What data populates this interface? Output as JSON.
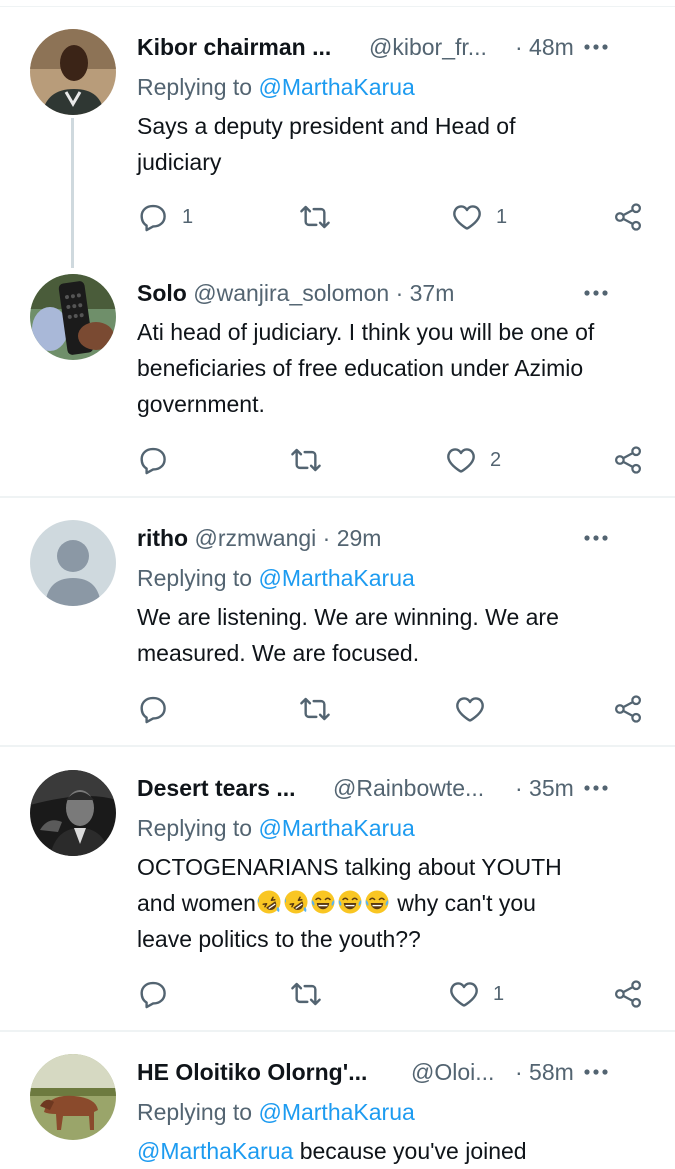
{
  "tweets": [
    {
      "name": "Kibor chairman ...",
      "handle": "@kibor_fr...",
      "time": "· 48m",
      "replying_prefix": "Replying to ",
      "replying_to": "@MarthaKarua",
      "text": "Says a deputy president and Head of judiciary",
      "replies": "1",
      "retweets": "",
      "likes": "1"
    },
    {
      "name": "Solo",
      "handle": "@wanjira_solomon",
      "time": "· 37m",
      "text": "Ati head of judiciary. I think you will be one of beneficiaries of free education under Azimio government.",
      "replies": "",
      "retweets": "",
      "likes": "2"
    },
    {
      "name": "ritho",
      "handle": "@rzmwangi",
      "time": "· 29m",
      "replying_prefix": "Replying to ",
      "replying_to": "@MarthaKarua",
      "text": "We are listening. We are winning. We are measured. We are focused.",
      "replies": "",
      "retweets": "",
      "likes": ""
    },
    {
      "name": "Desert tears ...",
      "handle": "@Rainbowte...",
      "time": "· 35m",
      "replying_prefix": "Replying to ",
      "replying_to": "@MarthaKarua",
      "text_line1": "OCTOGENARIANS talking about YOUTH",
      "text_line2a": "and women",
      "text_line2b": " why can't you",
      "text_line3": "leave politics to the youth??",
      "emojis": [
        "rofl",
        "rofl",
        "joy",
        "joy",
        "joy"
      ],
      "replies": "",
      "retweets": "",
      "likes": "1"
    },
    {
      "name": "HE Oloitiko Olorng'...",
      "handle": "@Oloi...",
      "time": "· 58m",
      "replying_prefix": "Replying to ",
      "replying_to": "@MarthaKarua",
      "text_mention": "@MarthaKarua",
      "text_rest": " because you've joined"
    }
  ],
  "icons": {
    "reply": "reply-icon",
    "retweet": "retweet-icon",
    "like": "heart-icon",
    "share": "share-icon",
    "more": "more-icon"
  },
  "colors": {
    "link": "#1d9bf0",
    "secondary": "#536471",
    "primary": "#0f1419",
    "divider": "#eff3f4"
  }
}
